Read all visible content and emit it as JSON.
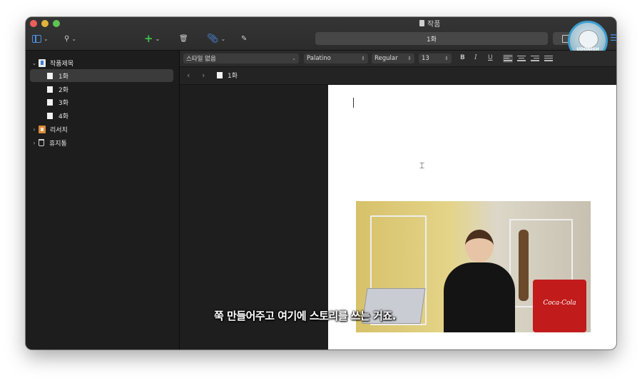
{
  "window": {
    "title": "작품"
  },
  "toolbar": {
    "document_title": "1화"
  },
  "avatar": {
    "label": "UDONISH"
  },
  "binder": {
    "items": [
      {
        "label": "작품제목"
      },
      {
        "label": "1화"
      },
      {
        "label": "2화"
      },
      {
        "label": "3화"
      },
      {
        "label": "4화"
      },
      {
        "label": "리서치"
      },
      {
        "label": "휴지통"
      }
    ]
  },
  "format_bar": {
    "style": "스타일 없음",
    "font": "Palatino",
    "weight": "Regular",
    "size": "13",
    "bold": "B",
    "italic": "I",
    "underline": "U"
  },
  "path_bar": {
    "document": "1화"
  },
  "video": {
    "fridge_text": "Coca-Cola"
  },
  "subtitle": "쭉 만들어주고 여기에 스토리를 쓰는 거죠."
}
